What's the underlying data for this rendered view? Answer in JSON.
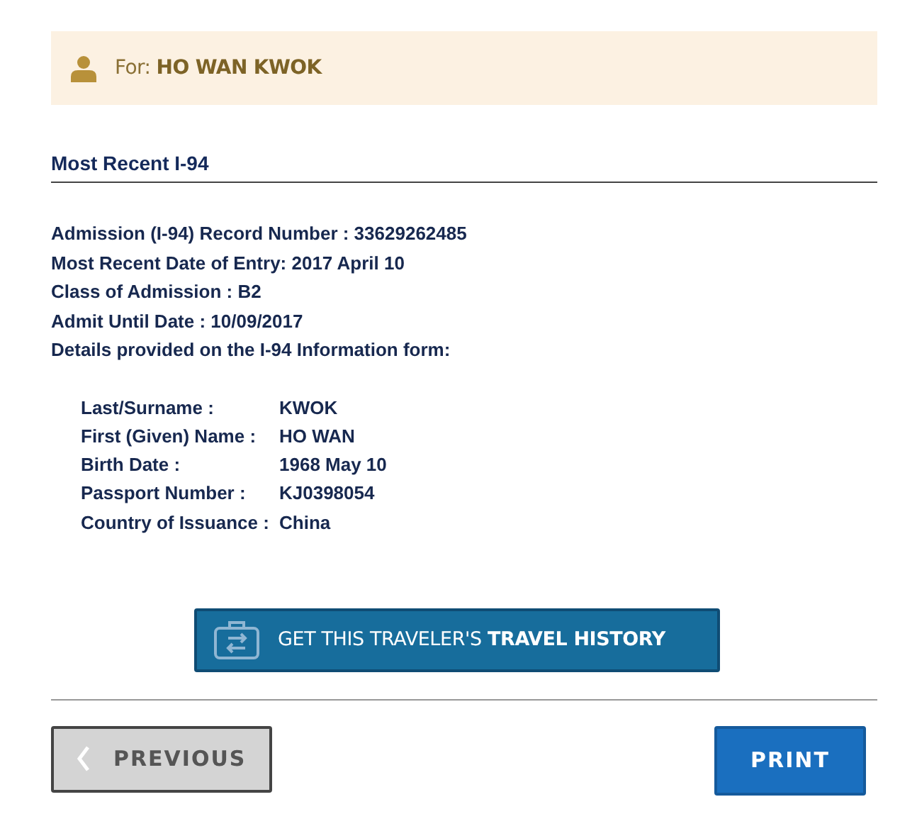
{
  "traveler_banner": {
    "text": "For: **HO WAN KWOK**"
  },
  "section": {
    "title": "Most Recent I-94"
  },
  "summary": [
    "Admission (I-94) Record Number : 33629262485",
    "Most Recent Date of Entry: 2017 April 10",
    "Class of Admission : B2",
    "Admit Until Date : 10/09/2017",
    "Details provided on the I-94 Information form:"
  ],
  "details": [
    {
      "label": "Last/Surname :",
      "value": "KWOK"
    },
    {
      "label": "First (Given) Name :",
      "value": "HO WAN"
    },
    {
      "label": "Birth Date :",
      "value": "1968 May 10"
    },
    {
      "label": "Passport Number :",
      "value": "KJ0398054"
    },
    {
      "label": "Country of Issuance :",
      "value": "China"
    }
  ],
  "travel_history_button": {
    "label": "GET THIS TRAVELER'S **TRAVEL HISTORY**"
  },
  "buttons": [
    {
      "kind": "previous",
      "label": "PREVIOUS"
    },
    {
      "kind": "print",
      "label": "PRINT"
    }
  ]
}
